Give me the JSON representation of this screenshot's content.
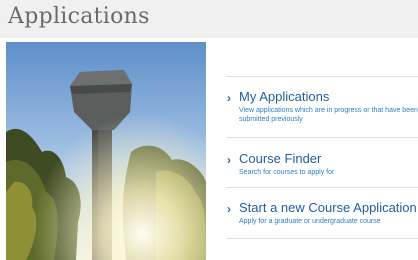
{
  "header": {
    "title": "Applications"
  },
  "hero": {
    "alt": "water-tower-photo"
  },
  "menu": {
    "items": [
      {
        "title": "My Applications",
        "description": "View applications which are in progress or that have been submitted previously"
      },
      {
        "title": "Course Finder",
        "description": "Search for courses to apply for"
      },
      {
        "title": "Start a new Course Application",
        "description": "Apply for a graduate or undergraduate course"
      }
    ]
  },
  "colors": {
    "link": "#1f5f9c",
    "header_bg": "#f0f0f0",
    "title": "#6a6a6a"
  },
  "icons": {
    "chevron": "chevron-right-icon"
  }
}
